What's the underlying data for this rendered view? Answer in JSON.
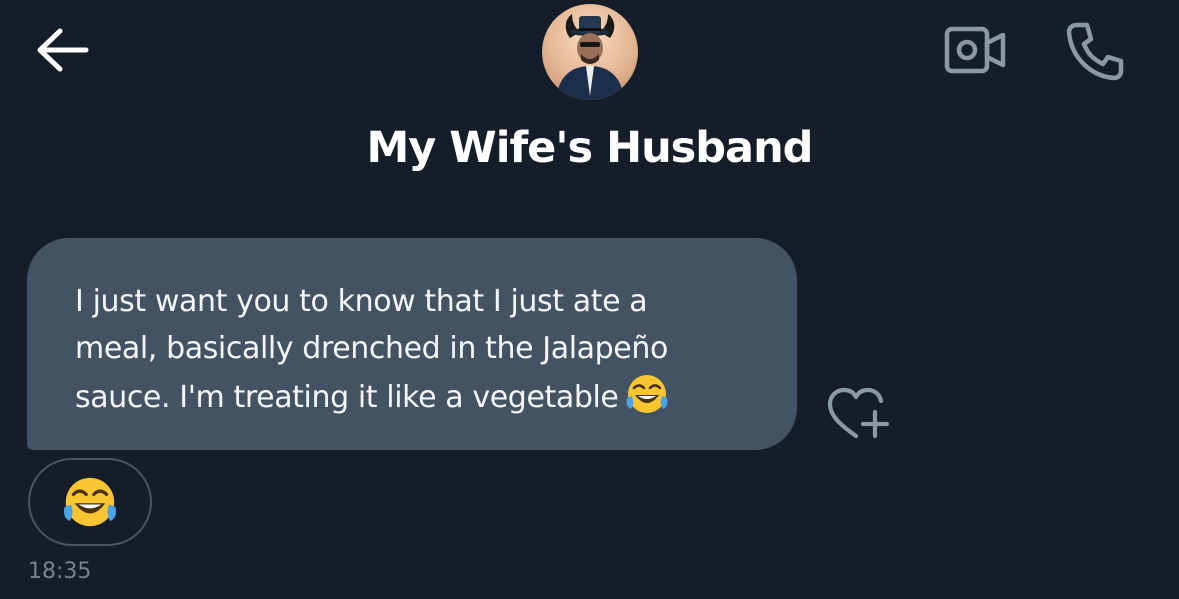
{
  "header": {
    "contact_name": "My Wife's Husband",
    "icons": {
      "back": "arrow-left-icon",
      "video": "video-camera-icon",
      "call": "phone-icon",
      "avatar": "profile-avatar"
    }
  },
  "message": {
    "text": "I just want you to know that I just ate a\nmeal, basically drenched in the Jalapeño\nsauce. I'm treating it like a vegetable",
    "emoji": "face-with-tears-of-joy",
    "react_icon": "heart-plus-icon",
    "reaction": {
      "emoji": "face-with-tears-of-joy"
    },
    "timestamp": "18:35"
  },
  "colors": {
    "background": "#151d28",
    "bubble": "#435363",
    "header_icon": "#8b98a5",
    "timestamp": "#768391",
    "emoji_yellow": "#f8c630",
    "tears_blue": "#4aa3e6"
  }
}
